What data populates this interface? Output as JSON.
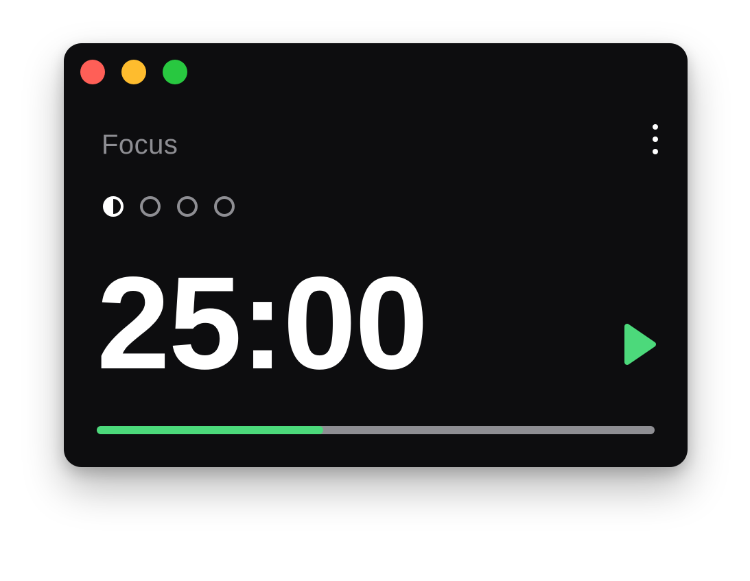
{
  "window": {
    "controls": [
      {
        "name": "close",
        "color": "#ff5f57"
      },
      {
        "name": "minimize",
        "color": "#febc2e"
      },
      {
        "name": "zoom",
        "color": "#28c840"
      }
    ]
  },
  "timer": {
    "mode_label": "Focus",
    "time": "25:00",
    "sessions": [
      "half",
      "empty",
      "empty",
      "empty"
    ],
    "progress_percent": 40.6,
    "accent_color": "#4cd97b"
  },
  "icons": {
    "menu": "vertical-ellipsis-icon",
    "play": "play-icon"
  }
}
